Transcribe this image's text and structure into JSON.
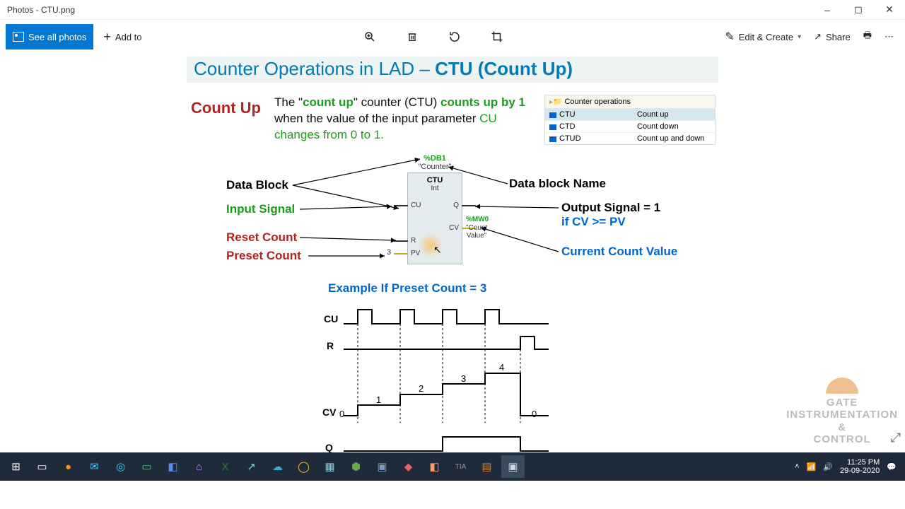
{
  "window": {
    "title": "Photos - CTU.png"
  },
  "toolbar": {
    "see_all": "See all photos",
    "add_to": "Add to",
    "edit_create": "Edit & Create",
    "share": "Share"
  },
  "slide": {
    "title_prefix": "Counter Operations in LAD – ",
    "title_bold": "CTU (Count Up)",
    "count_up": "Count Up",
    "desc_pre": "The \"",
    "desc_g1": "count up",
    "desc_mid1": "\" counter (CTU) ",
    "desc_g2": "counts up by 1",
    "desc_mid2": " when the value of the input parameter ",
    "desc_g3": "CU changes from 0 to 1.",
    "example": "Example If Preset Count = 3"
  },
  "legend": {
    "header": "Counter operations",
    "rows": [
      {
        "c1": "CTU",
        "c2": "Count up"
      },
      {
        "c1": "CTD",
        "c2": "Count down"
      },
      {
        "c1": "CTUD",
        "c2": "Count up and down"
      }
    ]
  },
  "block": {
    "db": "%DB1",
    "dbname": "\"Counter\"",
    "type": "CTU",
    "dtype": "Int",
    "pins": {
      "cu": "CU",
      "r": "R",
      "pv": "PV",
      "q": "Q",
      "cv": "CV"
    },
    "pv_value": "3",
    "mw0": "%MW0",
    "count_value": "\"Count Value\""
  },
  "annotations": {
    "data_block": "Data Block",
    "input_signal": "Input Signal",
    "reset_count": "Reset Count",
    "preset_count": "Preset Count",
    "db_name": "Data block Name",
    "out_sig": "Output Signal = 1",
    "out_cond": "if CV >= PV",
    "current_cv": "Current Count Value"
  },
  "timing": {
    "labels": {
      "cu": "CU",
      "r": "R",
      "cv": "CV",
      "q": "Q"
    },
    "counts": [
      "0",
      "1",
      "2",
      "3",
      "4",
      "0"
    ]
  },
  "watermark": {
    "l1": "GATE",
    "l2": "INSTRUMENTATION",
    "l3": "&",
    "l4": "CONTROL"
  },
  "tray": {
    "time": "11:25 PM",
    "date": "29-09-2020"
  }
}
